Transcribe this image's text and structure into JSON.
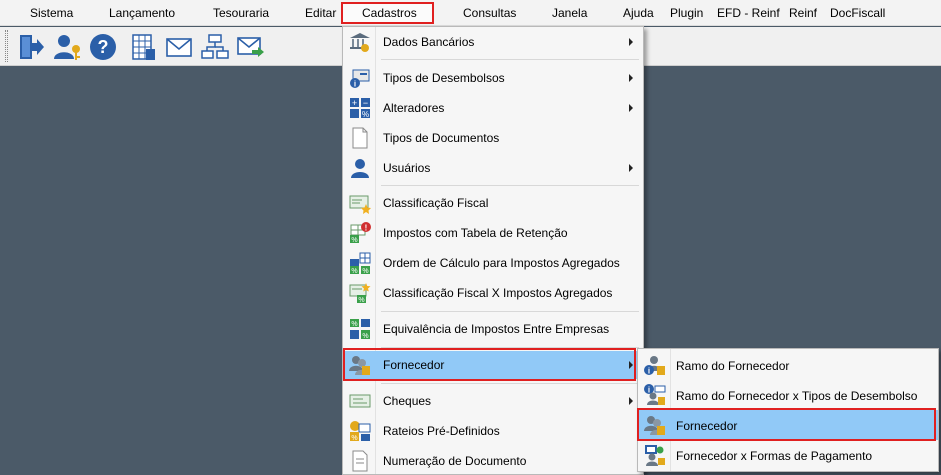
{
  "menubar": {
    "items": [
      "Sistema",
      "Lançamento",
      "Tesouraria",
      "Editar",
      "Cadastros",
      "Consultas",
      "Janela",
      "Ajuda",
      "Plugin",
      "EFD - Reinf",
      "Reinf",
      "DocFiscall"
    ]
  },
  "toolbar": {
    "buttons": [
      "exit-icon",
      "user-key-icon",
      "help-icon",
      "calculator-sheet-icon",
      "envelope-icon",
      "org-chart-icon",
      "mail-forward-icon"
    ]
  },
  "cadastros_menu": {
    "items": [
      {
        "label": "Dados Bancários",
        "icon": "bank-data-icon",
        "submenu": true
      },
      {
        "label": "Tipos de Desembolsos",
        "icon": "disbursement-types-icon",
        "submenu": true
      },
      {
        "label": "Alteradores",
        "icon": "modifiers-icon",
        "submenu": true
      },
      {
        "label": "Tipos de Documentos",
        "icon": "document-icon",
        "submenu": false
      },
      {
        "label": "Usuários",
        "icon": "user-icon",
        "submenu": true
      },
      {
        "label": "Classificação Fiscal",
        "icon": "fiscal-classification-icon",
        "submenu": false
      },
      {
        "label": "Impostos com Tabela de Retenção",
        "icon": "tax-retention-icon",
        "submenu": false
      },
      {
        "label": "Ordem de Cálculo para Impostos Agregados",
        "icon": "tax-calculation-order-icon",
        "submenu": false
      },
      {
        "label": "Classificação Fiscal X Impostos Agregados",
        "icon": "fiscal-tax-link-icon",
        "submenu": false
      },
      {
        "label": "Equivalência de Impostos Entre Empresas",
        "icon": "tax-equivalence-icon",
        "submenu": false
      },
      {
        "label": "Fornecedor",
        "icon": "supplier-icon",
        "submenu": true
      },
      {
        "label": "Cheques",
        "icon": "cheque-icon",
        "submenu": true
      },
      {
        "label": "Rateios Pré-Definidos",
        "icon": "apportionment-icon",
        "submenu": false
      },
      {
        "label": "Numeração de Documento",
        "icon": "document-numbering-icon",
        "submenu": false
      }
    ]
  },
  "fornecedor_submenu": {
    "items": [
      {
        "label": "Ramo do Fornecedor",
        "icon": "supplier-branch-icon"
      },
      {
        "label": "Ramo do Fornecedor x Tipos de Desembolso",
        "icon": "supplier-branch-disbursement-icon"
      },
      {
        "label": "Fornecedor",
        "icon": "supplier-icon"
      },
      {
        "label": "Fornecedor x Formas de Pagamento",
        "icon": "supplier-payment-icon"
      }
    ]
  },
  "colors": {
    "highlight": "#91c9f7",
    "annotation_red": "#e02020",
    "workspace": "#4b5a68"
  }
}
